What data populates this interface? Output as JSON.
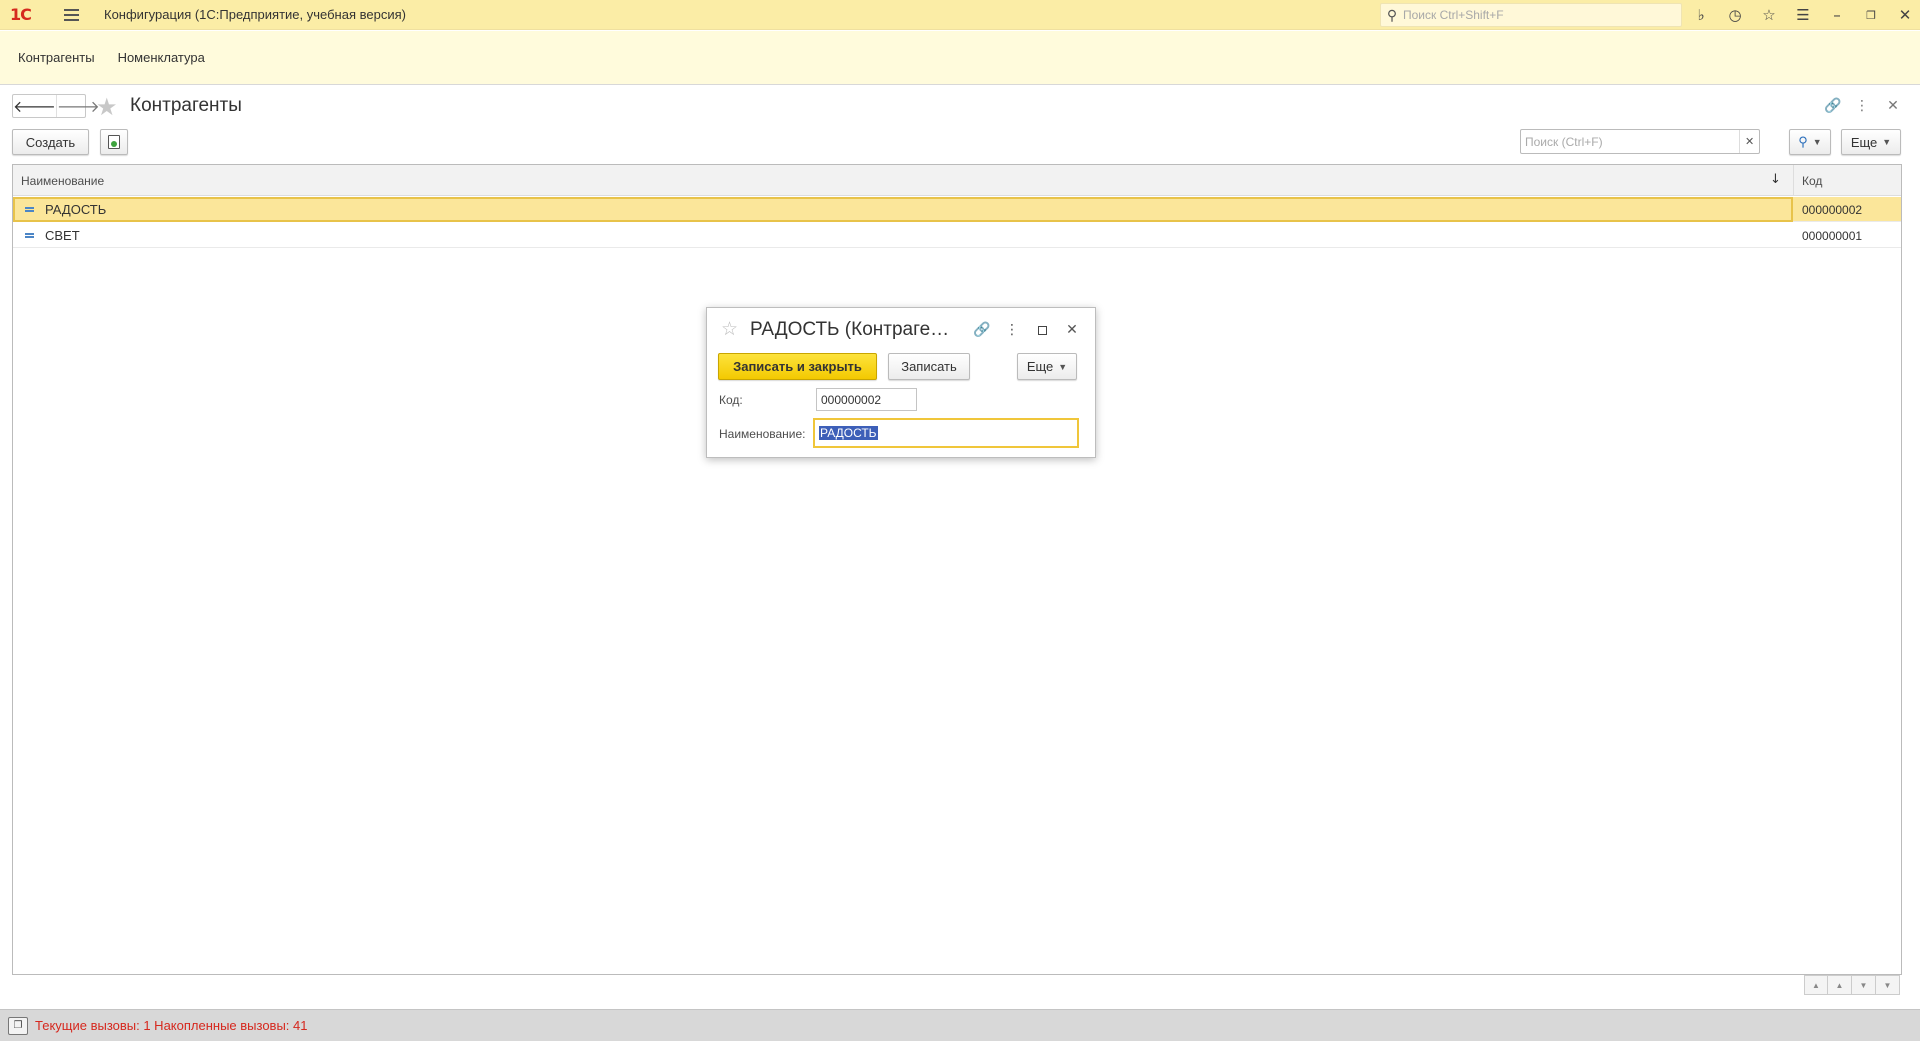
{
  "titlebar": {
    "logo": "1С",
    "title": "Конфигурация  (1С:Предприятие, учебная версия)",
    "search_placeholder": "Поиск Ctrl+Shift+F"
  },
  "sections": [
    {
      "label": "Контрагенты"
    },
    {
      "label": "Номенклатура"
    }
  ],
  "form": {
    "title": "Контрагенты",
    "create_label": "Создать",
    "search_placeholder": "Поиск (Ctrl+F)",
    "more_label": "Еще"
  },
  "table": {
    "columns": [
      "Наименование",
      "Код"
    ],
    "rows": [
      {
        "name": "РАДОСТЬ",
        "code": "000000002",
        "selected": true
      },
      {
        "name": "СВЕТ",
        "code": "000000001",
        "selected": false
      }
    ]
  },
  "dialog": {
    "title": "РАДОСТЬ (Контраге…",
    "save_close_label": "Записать и закрыть",
    "save_label": "Записать",
    "more_label": "Еще",
    "code_label": "Код:",
    "code_value": "000000002",
    "name_label": "Наименование:",
    "name_value": "РАДОСТЬ"
  },
  "statusbar": {
    "text": "Текущие вызовы: 1   Накопленные вызовы: 41"
  }
}
